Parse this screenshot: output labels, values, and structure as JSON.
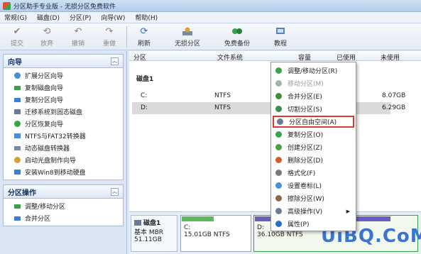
{
  "window": {
    "title": "分区助手专业版 - 无损分区免费软件"
  },
  "menubar": [
    {
      "label": "常规(G)"
    },
    {
      "label": "磁盘(D)"
    },
    {
      "label": "分区(P)"
    },
    {
      "label": "向导(W)"
    },
    {
      "label": "帮助(H)"
    }
  ],
  "toolbar": {
    "buttons": [
      {
        "label": "提交",
        "icon": "check-icon",
        "enabled": false
      },
      {
        "label": "放弃",
        "icon": "discard-icon",
        "enabled": false
      },
      {
        "label": "撤销",
        "icon": "undo-icon",
        "enabled": false
      },
      {
        "label": "重做",
        "icon": "redo-icon",
        "enabled": false
      },
      {
        "label": "刷新",
        "icon": "refresh-icon",
        "enabled": true
      },
      {
        "label": "无损分区",
        "icon": "lossless-partition-icon",
        "enabled": true
      },
      {
        "label": "免费备份",
        "icon": "backup-icon",
        "enabled": true
      },
      {
        "label": "教程",
        "icon": "tutorial-icon",
        "enabled": true
      }
    ]
  },
  "leftpanel": {
    "wizard": {
      "title": "向导",
      "items": [
        {
          "label": "扩展分区向导"
        },
        {
          "label": "复制磁盘向导"
        },
        {
          "label": "复制分区向导"
        },
        {
          "label": "迁移系统到固态磁盘"
        },
        {
          "label": "分区恢复向导"
        },
        {
          "label": "NTFS与FAT32转换器"
        },
        {
          "label": "动态磁盘转换器"
        },
        {
          "label": "启动光盘制作向导"
        },
        {
          "label": "安装Win8到移动硬盘"
        }
      ]
    },
    "partition_ops": {
      "title": "分区操作",
      "items": [
        {
          "label": "调整/移动分区"
        },
        {
          "label": "合并分区"
        }
      ]
    }
  },
  "table": {
    "headers": {
      "partition": "分区",
      "filesystem": "文件系统",
      "capacity": "容量",
      "used": "已使用",
      "unused": "未使用"
    },
    "disk_label": "磁盘1",
    "rows": [
      {
        "partition": "C:",
        "filesystem": "NTFS",
        "unused": "8.07GB"
      },
      {
        "partition": "D:",
        "filesystem": "NTFS",
        "unused": "6.29GB"
      }
    ]
  },
  "diskmap": {
    "disk": {
      "name": "磁盘1",
      "type": "基本 MBR",
      "size": "51.11GB"
    },
    "partitions": [
      {
        "label": "C:",
        "info": "15.01GB NTFS",
        "used_fraction": 0.46
      },
      {
        "label": "D:",
        "info": "36.10GB NTFS",
        "used_fraction": 0.83
      }
    ]
  },
  "context_menu": {
    "items": [
      {
        "label": "调整/移动分区(R)",
        "enabled": true
      },
      {
        "label": "移动分区(M)",
        "enabled": false
      },
      {
        "label": "合并分区(E)",
        "enabled": true
      },
      {
        "label": "切割分区(S)",
        "enabled": true
      },
      {
        "label": "分区自由空间(A)",
        "enabled": true,
        "highlighted": true
      },
      {
        "label": "复制分区(O)",
        "enabled": true
      },
      {
        "label": "创建分区(Z)",
        "enabled": true
      },
      {
        "label": "删除分区(D)",
        "enabled": true
      },
      {
        "label": "格式化(F)",
        "enabled": true
      },
      {
        "label": "设置卷标(L)",
        "enabled": true
      },
      {
        "label": "擦除分区(W)",
        "enabled": true
      },
      {
        "label": "高级操作(V)",
        "enabled": true,
        "submenu": true
      },
      {
        "label": "属性(P)",
        "enabled": true
      }
    ],
    "highlight_color": "#d83a32"
  },
  "watermark": "UiBQ.CoM"
}
